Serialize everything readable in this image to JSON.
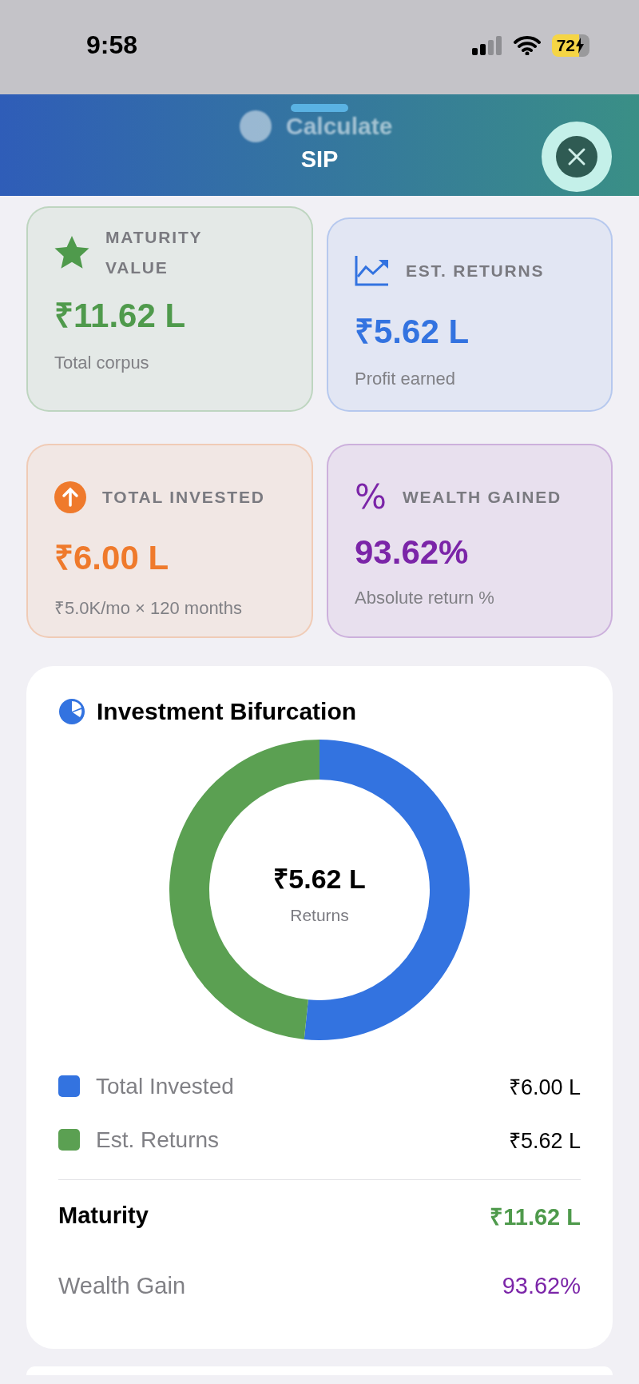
{
  "status_bar": {
    "time": "9:58",
    "battery": "72"
  },
  "sheet": {
    "background_button": "Calculate",
    "title": "SIP"
  },
  "stat_cards": [
    {
      "label": "MATURITY VALUE",
      "value": "₹11.62 L",
      "caption": "Total corpus",
      "color": "#4f9a4c",
      "kind": "star"
    },
    {
      "label": "EST. RETURNS",
      "value": "₹5.62 L",
      "caption": "Profit earned",
      "color": "#3373e0",
      "kind": "chart"
    },
    {
      "label": "TOTAL INVESTED",
      "value": "₹6.00 L",
      "caption": "₹5.0K/mo × 120 months",
      "color": "#ef7a2c",
      "kind": "arrow"
    },
    {
      "label": "WEALTH GAINED",
      "value": "93.62%",
      "caption": "Absolute return %",
      "color": "#7b25a8",
      "kind": "percent",
      "icon_text": "%"
    }
  ],
  "bifurcation": {
    "title": "Investment Bifurcation",
    "center_value": "₹5.62 L",
    "center_label": "Returns",
    "chart_data": {
      "type": "donut",
      "categories": [
        "Total Invested",
        "Est. Returns"
      ],
      "values": [
        51.63,
        48.37
      ]
    },
    "legend": [
      {
        "value": "₹6.00 L",
        "color": "#3373e0"
      },
      {
        "value": "₹5.62 L",
        "color": "#5ba052"
      }
    ],
    "summary": [
      {
        "label": "Maturity",
        "value": "₹11.62 L",
        "kind": "total",
        "color": "#4f9a4c"
      },
      {
        "label": "Wealth Gain",
        "value": "93.62%",
        "kind": "plain",
        "color": "#7b25a8"
      }
    ]
  }
}
